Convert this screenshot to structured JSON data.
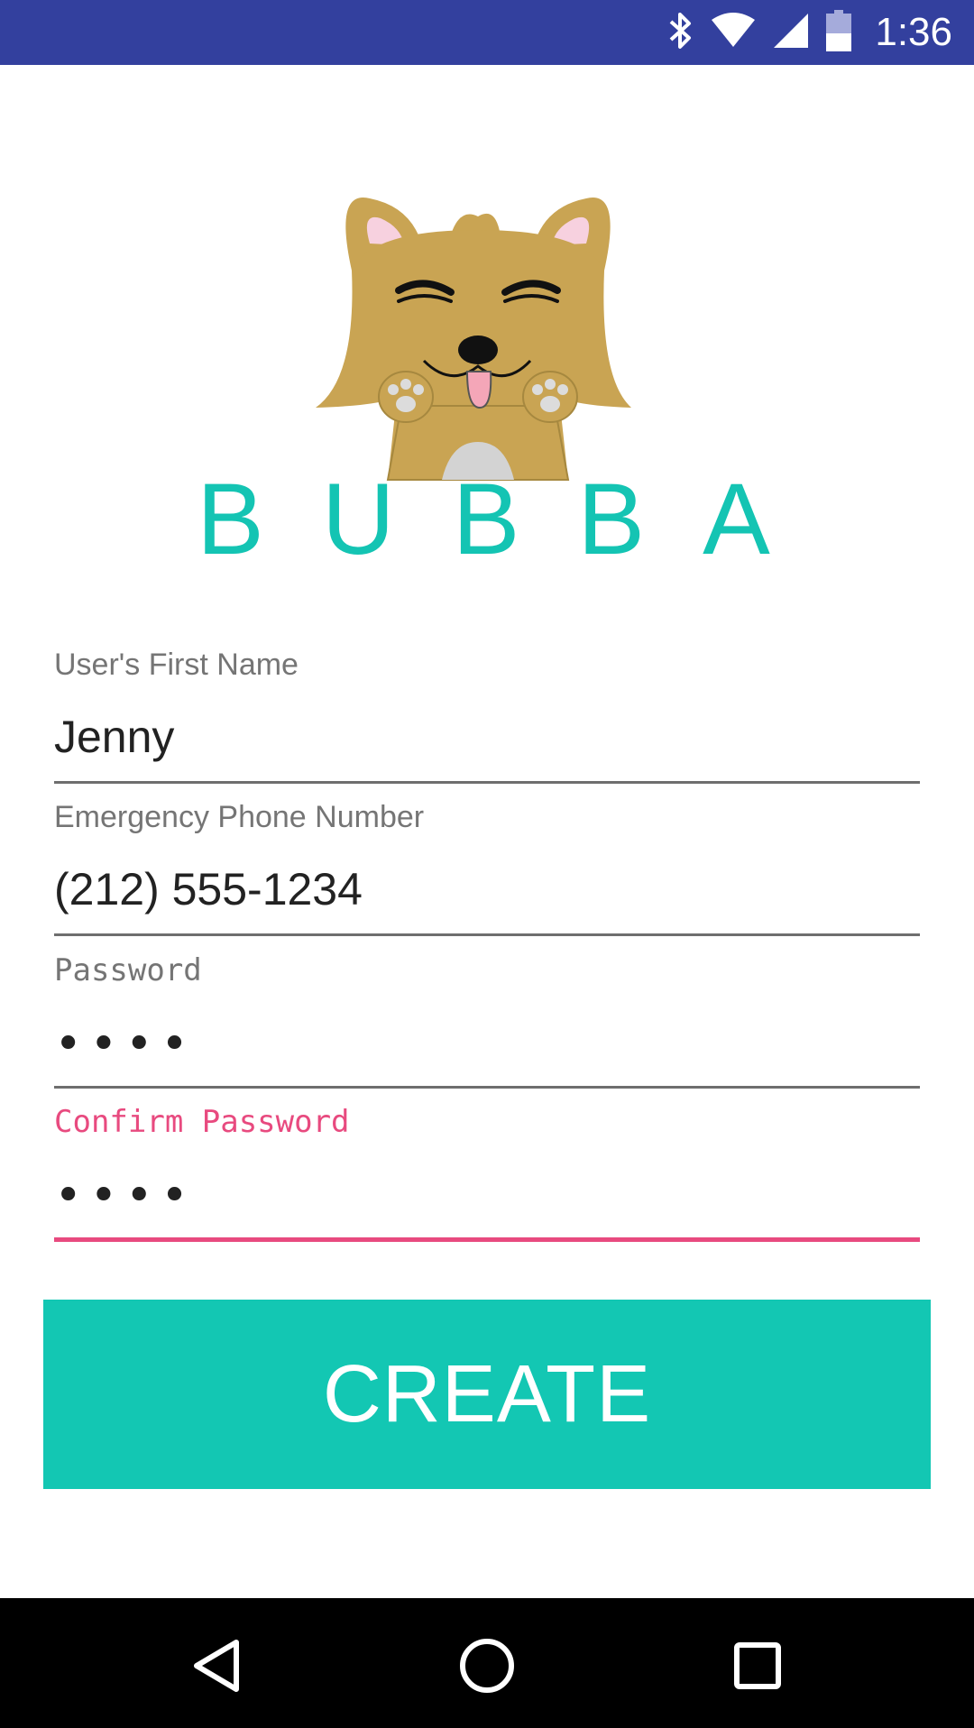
{
  "status_bar": {
    "time": "1:36",
    "icons": [
      "bluetooth-icon",
      "wifi-icon",
      "cell-signal-icon",
      "battery-icon"
    ],
    "background": "#33409e"
  },
  "logo": {
    "wordmark": "BUBBA",
    "wordmark_color": "#14c4b3"
  },
  "form": {
    "first_name": {
      "label": "User's First Name",
      "value": "Jenny"
    },
    "phone": {
      "label": "Emergency Phone Number",
      "value": "(212) 555-1234"
    },
    "password": {
      "label": "Password",
      "value": "••••"
    },
    "confirm_password": {
      "label": "Confirm Password",
      "value": "••••",
      "focused": true,
      "accent_color": "#e84a7f"
    }
  },
  "create_button": {
    "label": "CREATE",
    "color": "#13c7b3"
  },
  "nav_bar": {
    "buttons": [
      "back-icon",
      "home-icon",
      "recents-icon"
    ]
  }
}
